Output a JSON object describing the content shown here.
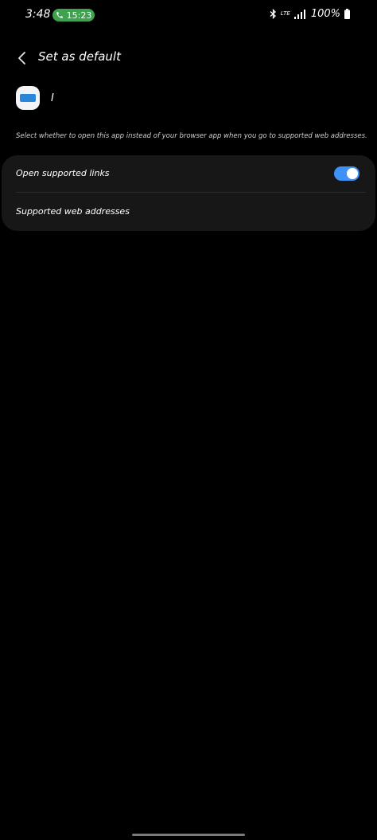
{
  "status_bar": {
    "time": "3:48",
    "call_timer": "15:23",
    "network": "LTE",
    "battery": "100%"
  },
  "header": {
    "title": "Set as default",
    "back_icon": "chevron-left-icon"
  },
  "app": {
    "name": "I",
    "icon": "app-icon"
  },
  "description": "Select whether to open this app instead of your browser app when you go to supported web addresses.",
  "settings": {
    "open_supported_links": {
      "label": "Open supported links",
      "enabled": true
    },
    "supported_web_addresses": {
      "label": "Supported web addresses"
    }
  },
  "colors": {
    "accent": "#3e91f6",
    "call_pill": "#3ea24e",
    "card": "#171717",
    "background": "#000000"
  }
}
